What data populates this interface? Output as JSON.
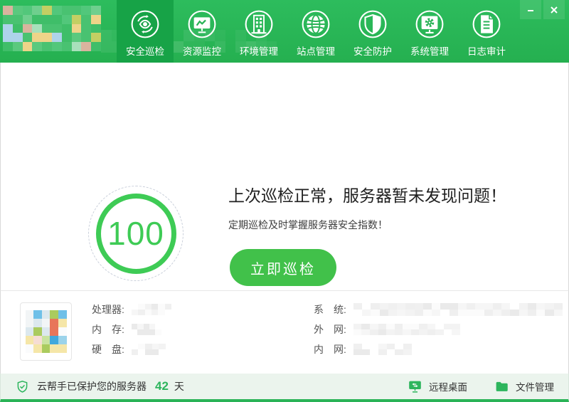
{
  "nav": {
    "items": [
      {
        "label": "安全巡检",
        "active": true
      },
      {
        "label": "资源监控",
        "active": false
      },
      {
        "label": "环境管理",
        "active": false
      },
      {
        "label": "站点管理",
        "active": false
      },
      {
        "label": "安全防护",
        "active": false
      },
      {
        "label": "系统管理",
        "active": false
      },
      {
        "label": "日志审计",
        "active": false
      }
    ]
  },
  "hero": {
    "score": "100",
    "title": "上次巡检正常，服务器暂未发现问题！",
    "subtitle": "定期巡检及时掌握服务器安全指数！",
    "inspect_button": "立即巡检"
  },
  "system_info": {
    "processor_label": "处理器:",
    "memory_label": "内　存:",
    "disk_label": "硬　盘:",
    "os_label": "系　统:",
    "wan_label": "外　网:",
    "lan_label": "内　网:"
  },
  "footer": {
    "protected_text": "云帮手已保护您的服务器",
    "protected_days": "42",
    "days_unit": "天",
    "remote_desktop_label": "远程桌面",
    "file_manager_label": "文件管理"
  },
  "colors": {
    "header_green": "#2ab357",
    "active_tab_green": "#17a347",
    "accent_green": "#3ecb55",
    "button_green": "#41c14a",
    "footer_green": "#2db55d"
  }
}
